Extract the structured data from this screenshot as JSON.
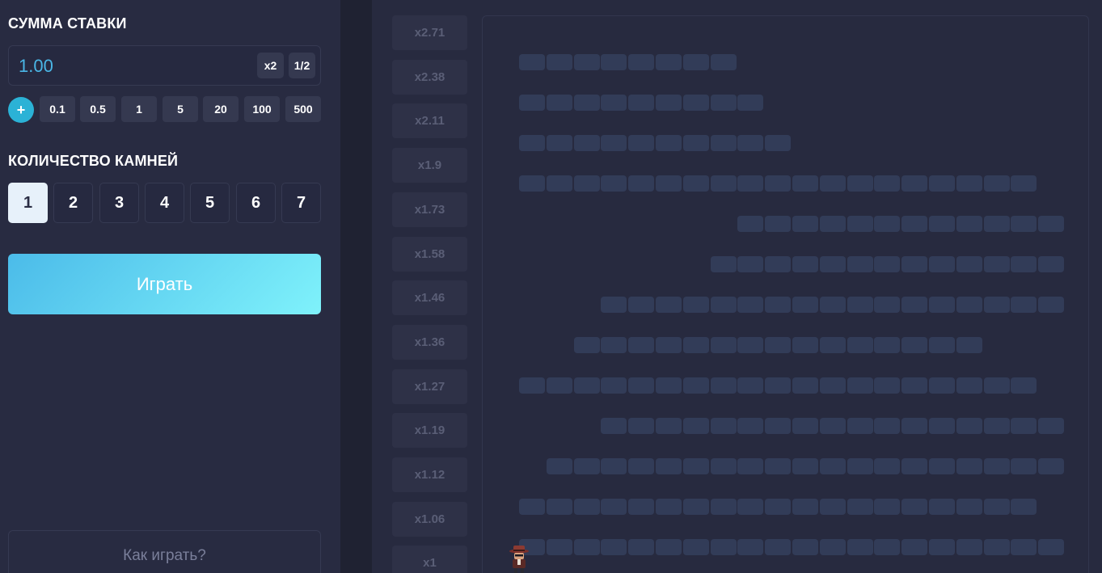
{
  "bet": {
    "title": "СУММА СТАВКИ",
    "value": "1.00",
    "double_label": "x2",
    "half_label": "1/2",
    "plus_label": "+",
    "chips": [
      "0.1",
      "0.5",
      "1",
      "5",
      "20",
      "100",
      "500"
    ]
  },
  "stones": {
    "title": "КОЛИЧЕСТВО КАМНЕЙ",
    "options": [
      "1",
      "2",
      "3",
      "4",
      "5",
      "6",
      "7"
    ],
    "selected": "1"
  },
  "play_label": "Играть",
  "how_to_play_label": "Как играть?",
  "multipliers": [
    "x2.71",
    "x2.38",
    "x2.11",
    "x1.9",
    "x1.73",
    "x1.58",
    "x1.46",
    "x1.36",
    "x1.27",
    "x1.19",
    "x1.12",
    "x1.06",
    "x1"
  ],
  "board_rows": [
    {
      "start": 0,
      "count": 8
    },
    {
      "start": 0,
      "count": 9
    },
    {
      "start": 0,
      "count": 10
    },
    {
      "start": 0,
      "count": 19
    },
    {
      "start": 8,
      "count": 12
    },
    {
      "start": 7,
      "count": 13
    },
    {
      "start": 3,
      "count": 17
    },
    {
      "start": 2,
      "count": 15
    },
    {
      "start": 0,
      "count": 19
    },
    {
      "start": 3,
      "count": 17
    },
    {
      "start": 1,
      "count": 19
    },
    {
      "start": 0,
      "count": 19
    },
    {
      "start": 0,
      "count": 20
    }
  ],
  "colors": {
    "accent": "#4ab6e6",
    "play_gradient_start": "#4bbbe9",
    "play_gradient_end": "#7ff2fb",
    "cell": "#323c58"
  },
  "icons": {
    "player": "detective-character-icon",
    "plus": "plus-icon"
  }
}
